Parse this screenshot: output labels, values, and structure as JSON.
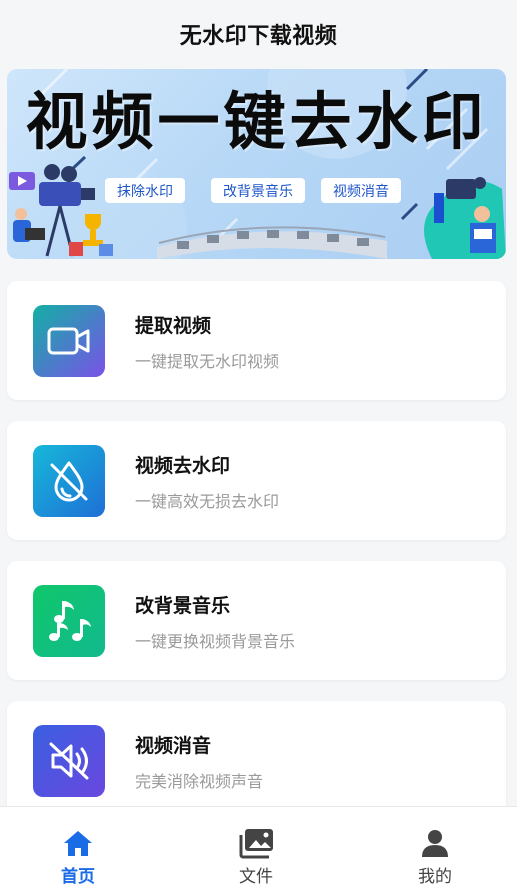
{
  "header": {
    "title": "无水印下载视频"
  },
  "banner": {
    "title": "视频一键去水印",
    "tags": [
      "抹除水印",
      "改背景音乐",
      "视频消音"
    ]
  },
  "features": [
    {
      "name": "提取视频",
      "desc": "一键提取无水印视频",
      "icon": "video-camera-icon",
      "colors": [
        "#12b0a4",
        "#7a52e8"
      ]
    },
    {
      "name": "视频去水印",
      "desc": "一键高效无损去水印",
      "icon": "watermark-off-icon",
      "colors": [
        "#16b8d9",
        "#1f6fd6"
      ]
    },
    {
      "name": "改背景音乐",
      "desc": "一键更换视频背景音乐",
      "icon": "music-notes-icon",
      "colors": [
        "#10c76a",
        "#12b98e"
      ]
    },
    {
      "name": "视频消音",
      "desc": "完美消除视频声音",
      "icon": "speaker-mute-icon",
      "colors": [
        "#3a5fe0",
        "#6a48e0"
      ]
    }
  ],
  "tabbar": {
    "items": [
      {
        "label": "首页",
        "icon": "home-icon",
        "active": true
      },
      {
        "label": "文件",
        "icon": "photo-library-icon",
        "active": false
      },
      {
        "label": "我的",
        "icon": "person-icon",
        "active": false
      }
    ],
    "active_color": "#1a6be6",
    "inactive_color": "#444444"
  }
}
